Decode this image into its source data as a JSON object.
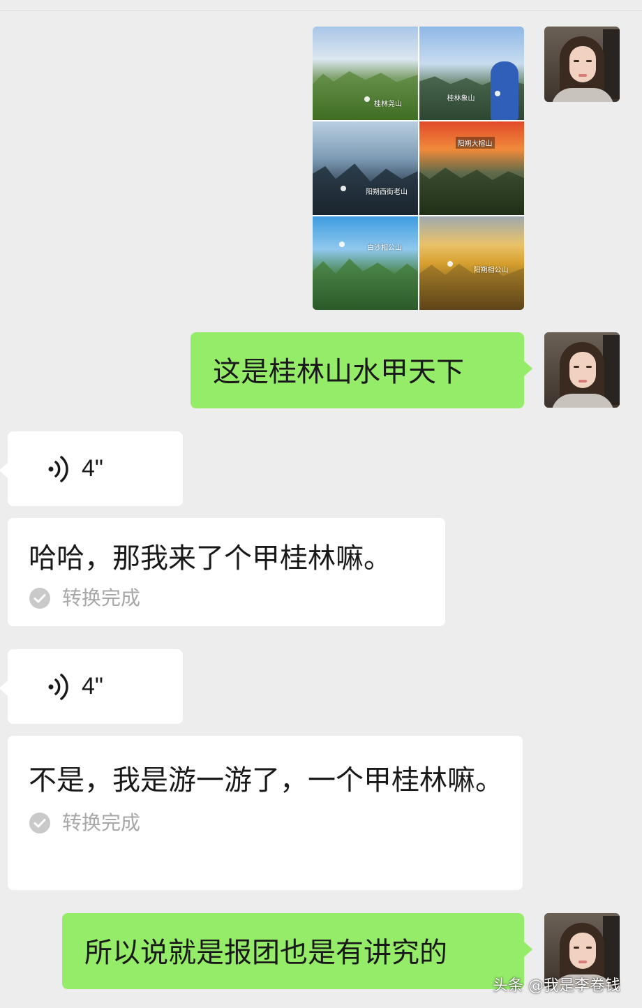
{
  "photo_album": {
    "tiles": [
      {
        "label": "桂林尧山"
      },
      {
        "label": "桂林象山"
      },
      {
        "label": "阳朔西街老山"
      },
      {
        "label": "阳朔大榕山"
      },
      {
        "label": "白沙相公山"
      },
      {
        "label": "阳朔相公山"
      }
    ]
  },
  "messages": {
    "m1_text": "这是桂林山水甲天下",
    "m2_voice_duration": "4\"",
    "m3_text": "哈哈，那我来了个甲桂林嘛。",
    "m3_status": "转换完成",
    "m4_voice_duration": "4\"",
    "m5_text": "不是，我是游一游了，一个甲桂林嘛。",
    "m5_status": "转换完成",
    "m6_text": "所以说就是报团也是有讲究的"
  },
  "watermark": "头条 @我是李卷钱",
  "colors": {
    "background": "#ededed",
    "sent_bubble": "#95ec69",
    "received_bubble": "#ffffff",
    "status_text": "#a7a7a7"
  },
  "icons": {
    "voice": "voice-wave-icon",
    "status": "check-circle-icon"
  }
}
